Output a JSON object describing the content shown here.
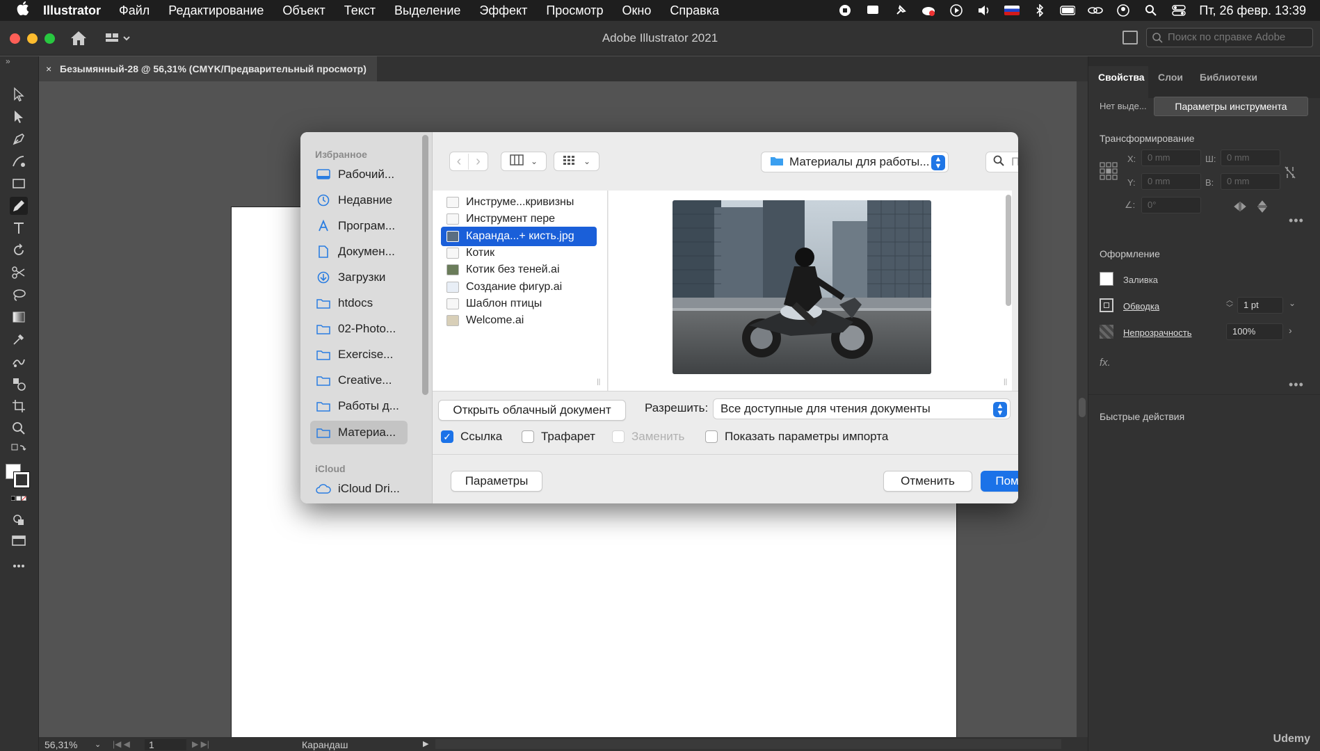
{
  "menubar": {
    "app": "Illustrator",
    "items": [
      "Файл",
      "Редактирование",
      "Объект",
      "Текст",
      "Выделение",
      "Эффект",
      "Просмотр",
      "Окно",
      "Справка"
    ],
    "datetime": "Пт, 26 февр.  13:39"
  },
  "window": {
    "title": "Adobe Illustrator 2021",
    "help_placeholder": "Поиск по справке Adobe"
  },
  "document_tab": {
    "close": "×",
    "label": "Безымянный-28 @ 56,31% (CMYK/Предварительный просмотр)"
  },
  "right_panel": {
    "tabs": [
      "Свойства",
      "Слои",
      "Библиотеки"
    ],
    "no_selection": "Нет выде...",
    "tool_params_button": "Параметры инструмента",
    "transform_title": "Трансформирование",
    "x_label": "X:",
    "y_label": "Y:",
    "w_label": "Ш:",
    "h_label": "В:",
    "x_value": "0 mm",
    "y_value": "0 mm",
    "w_value": "0 mm",
    "h_value": "0 mm",
    "angle_value": "0°",
    "appearance_title": "Оформление",
    "fill_label": "Заливка",
    "stroke_label": "Обводка",
    "stroke_value": "1 pt",
    "opacity_label": "Непрозрачность",
    "opacity_value": "100%",
    "fx_label": "fx.",
    "quick_actions_title": "Быстрые действия"
  },
  "status_bar": {
    "zoom": "56,31%",
    "artboard": "1",
    "tool": "Карандаш"
  },
  "dialog": {
    "sidebar": {
      "favorites_header": "Избранное",
      "favorites": [
        {
          "label": "Рабочий...",
          "icon": "desktop-icon"
        },
        {
          "label": "Недавние",
          "icon": "clock-icon"
        },
        {
          "label": "Програм...",
          "icon": "applications-icon"
        },
        {
          "label": "Докумен...",
          "icon": "document-icon"
        },
        {
          "label": "Загрузки",
          "icon": "download-icon"
        },
        {
          "label": "htdocs",
          "icon": "folder-icon"
        },
        {
          "label": "02-Photo...",
          "icon": "folder-icon"
        },
        {
          "label": "Exercise...",
          "icon": "folder-icon"
        },
        {
          "label": "Creative...",
          "icon": "folder-icon"
        },
        {
          "label": "Работы д...",
          "icon": "folder-icon"
        },
        {
          "label": "Материа...",
          "icon": "folder-icon"
        }
      ],
      "icloud_header": "iCloud",
      "icloud_item": "iCloud Dri..."
    },
    "location": "Материалы для работы...",
    "search_placeholder": "Поиск",
    "files": [
      "Инструме...кривизны",
      "Инструмент пере",
      "Каранда...+ кисть.jpg",
      "Котик",
      "Котик без теней.ai",
      "Создание фигур.ai",
      "Шаблон птицы",
      "Welcome.ai"
    ],
    "selected_file_index": 2,
    "open_cloud_button": "Открыть облачный документ",
    "enable_label": "Разрешить:",
    "enable_value": "Все доступные для чтения документы",
    "checkbox_link": "Ссылка",
    "checkbox_template": "Трафарет",
    "checkbox_replace": "Заменить",
    "checkbox_import_options": "Показать параметры импорта",
    "options_button": "Параметры",
    "cancel_button": "Отменить",
    "place_button": "Поместить"
  },
  "watermark": "Udemy",
  "colors": {
    "accent": "#1b72e8",
    "selection": "#1a5fd9",
    "ui_dark": "#323232",
    "canvas": "#535353"
  }
}
